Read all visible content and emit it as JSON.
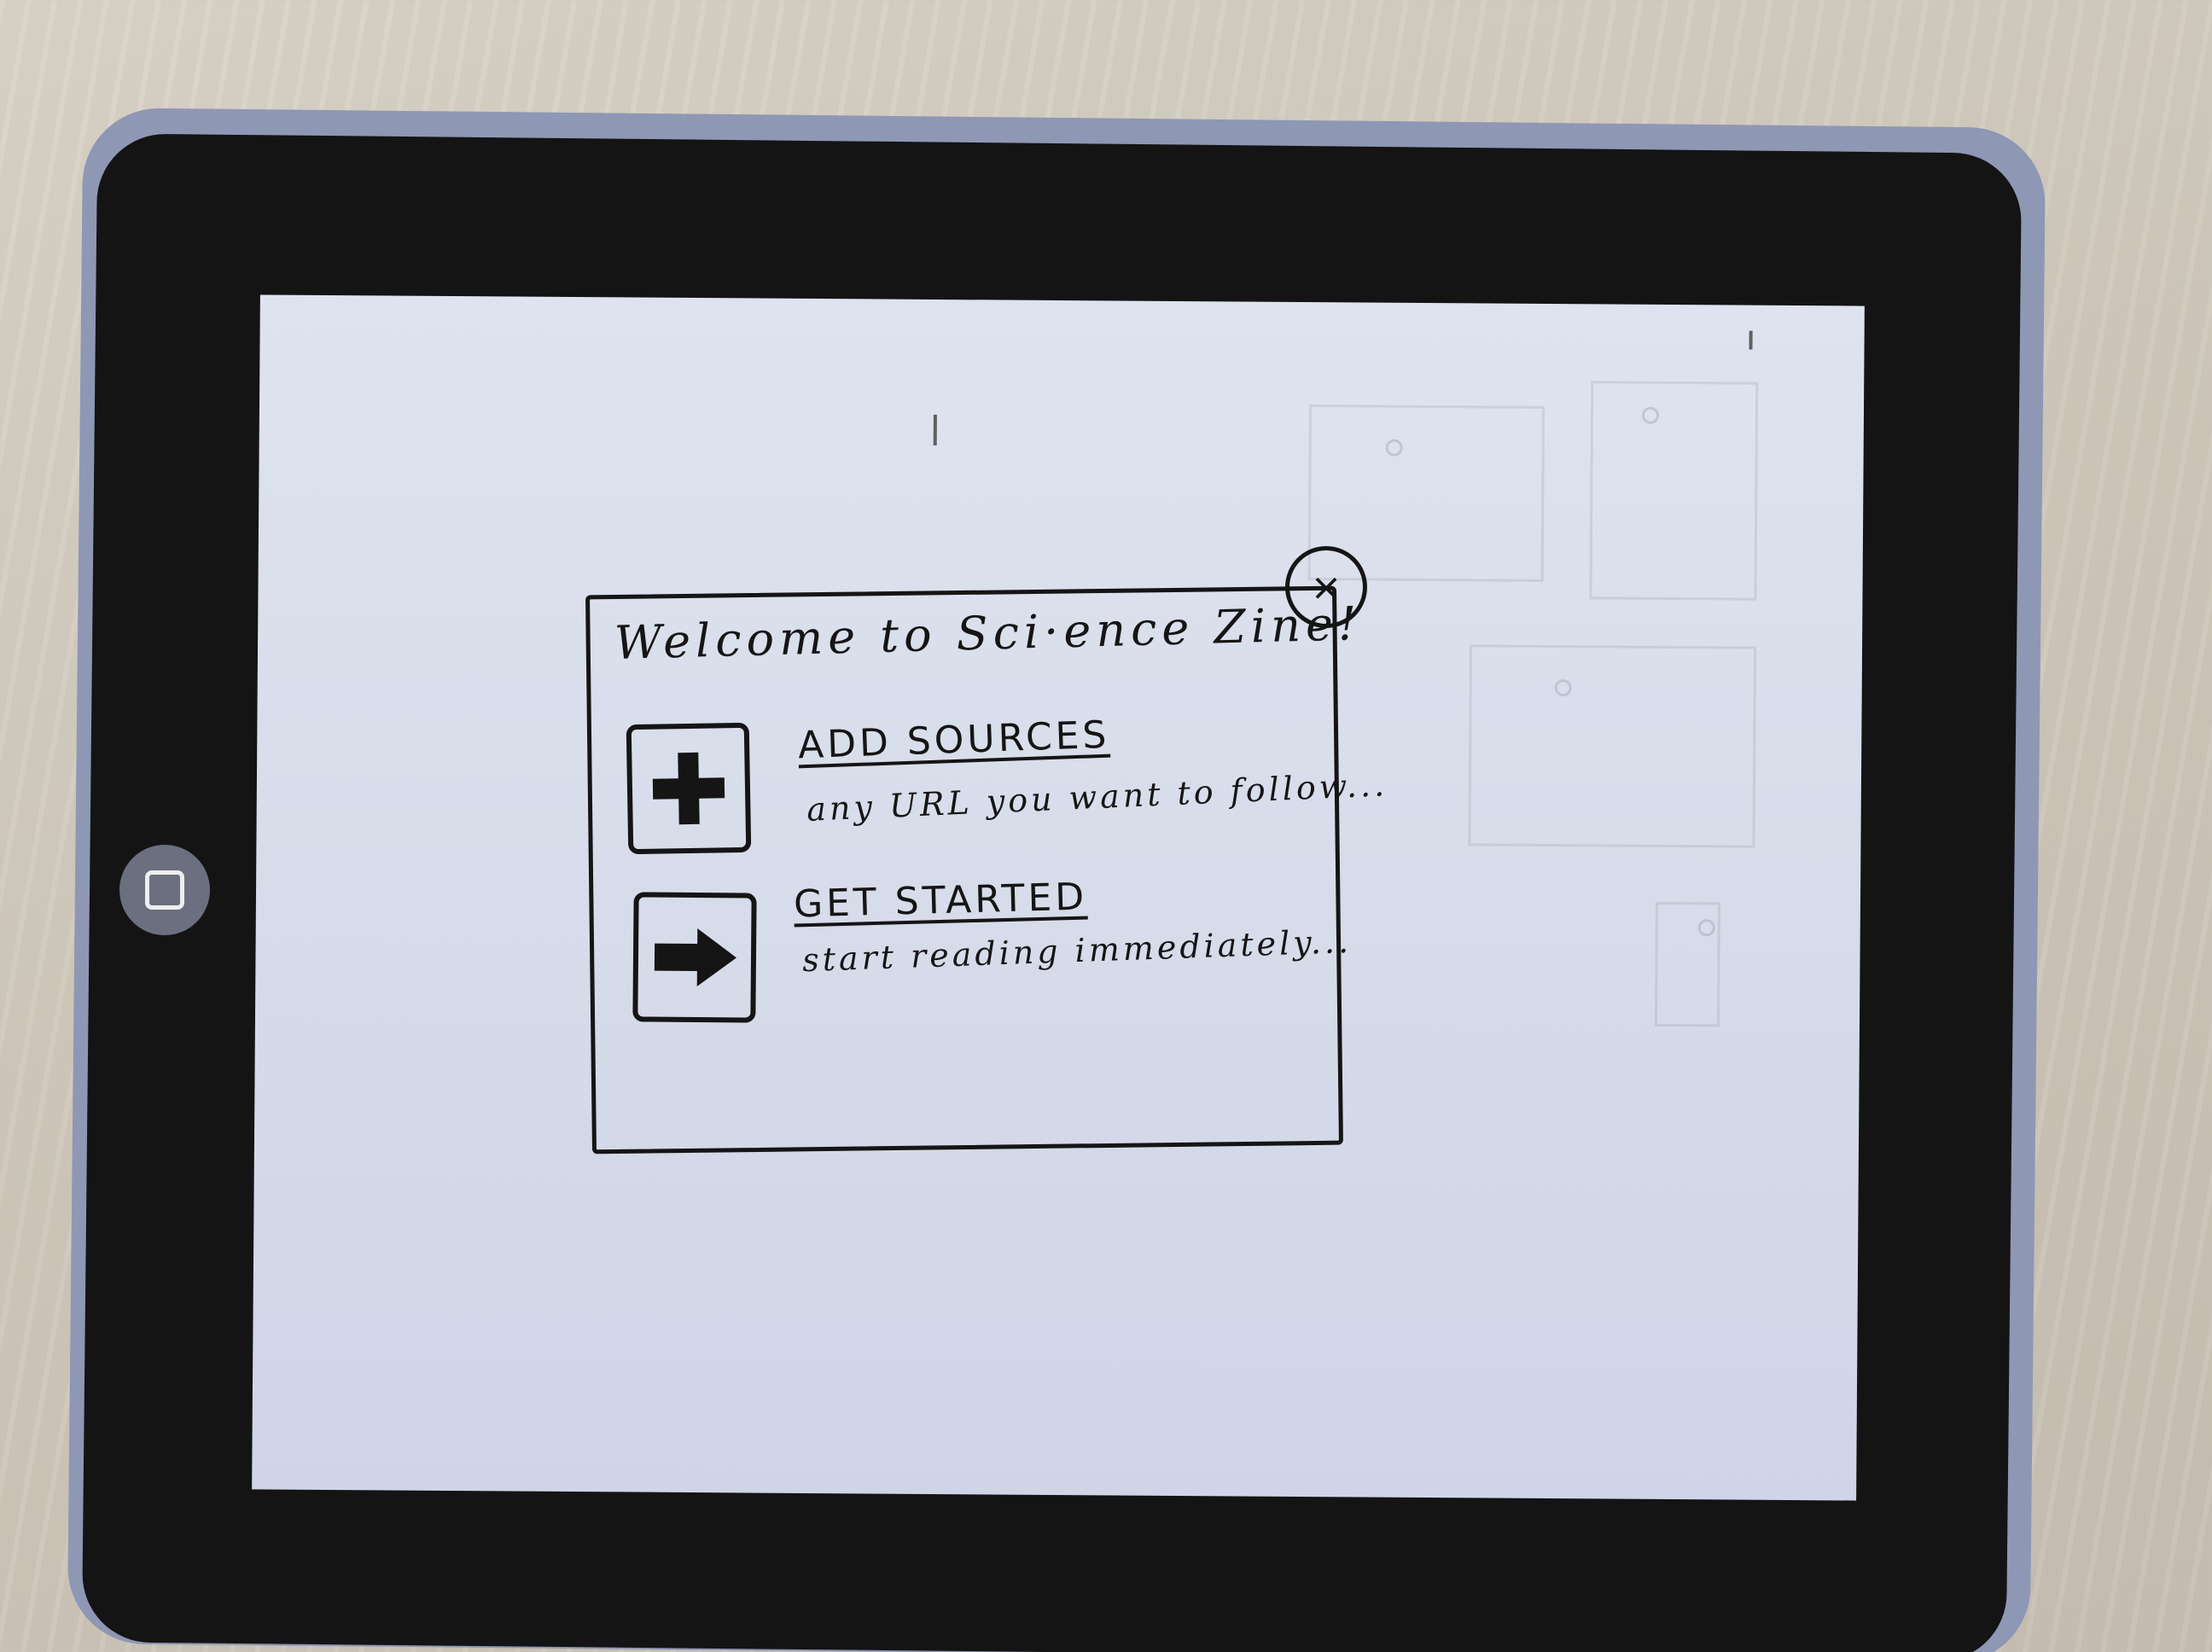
{
  "dialog": {
    "title": "Welcome to Sci·ence Zine!",
    "close_label": "×",
    "actions": [
      {
        "label": "ADD SOURCES",
        "description": "any URL you want to follow...",
        "icon": "plus-icon"
      },
      {
        "label": "GET STARTED",
        "description": "start reading immediately...",
        "icon": "arrow-right-icon"
      }
    ]
  },
  "colors": {
    "ink": "#151515",
    "paper": "#d7dcea",
    "bezel": "#141414"
  }
}
